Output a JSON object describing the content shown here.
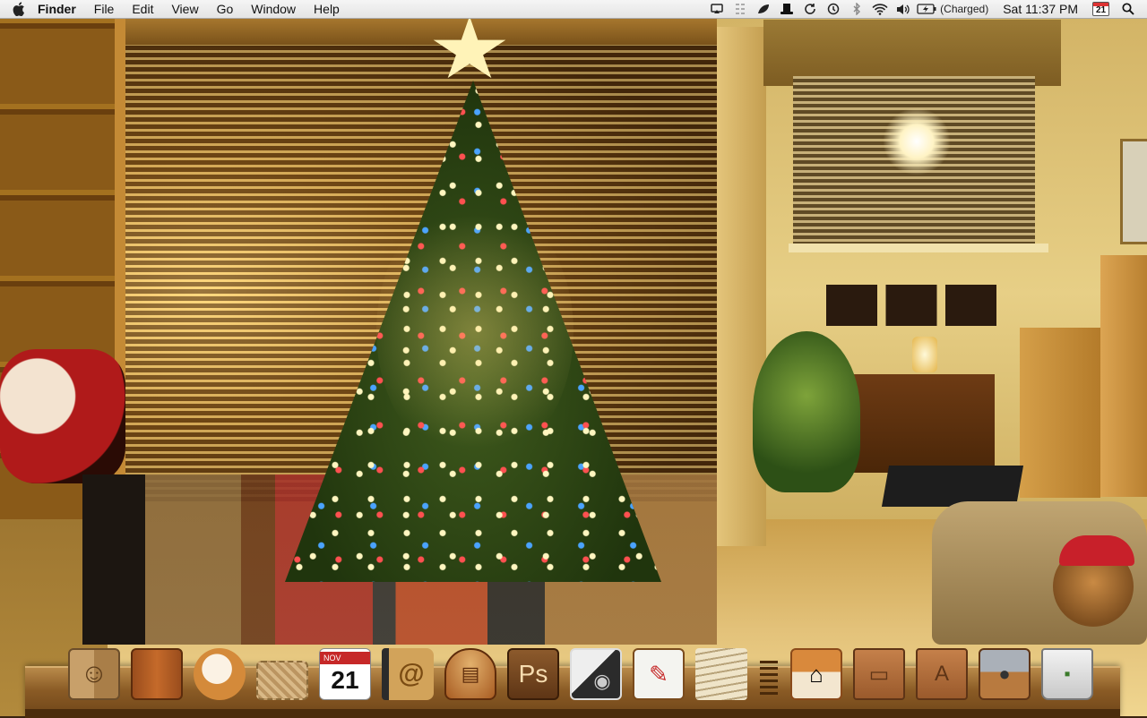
{
  "menubar": {
    "apple_icon": "apple-logo",
    "app_name": "Finder",
    "menus": [
      "File",
      "Edit",
      "View",
      "Go",
      "Window",
      "Help"
    ],
    "status_icons": [
      "airplay-icon",
      "grid-icon",
      "leaf-icon",
      "hat-icon",
      "sync-icon",
      "time-machine-icon",
      "bluetooth-icon",
      "wifi-icon",
      "volume-icon",
      "battery-icon"
    ],
    "battery_status": "(Charged)",
    "clock": "Sat 11:37 PM",
    "calendar_day": "21",
    "spotlight_icon": "search-icon"
  },
  "dock": {
    "ical_month": "NOV",
    "ical_day": "21",
    "photoshop_label": "Ps",
    "address_book_label": "@",
    "items": [
      "finder-icon",
      "apple-wood-icon",
      "squirrel-icon",
      "mail-stamp-icon",
      "ical-icon",
      "address-book-icon",
      "radio-icon",
      "photoshop-icon",
      "photo-camera-icon",
      "textedit-icon",
      "papers-icon",
      "home-folder-icon",
      "documents-folder-icon",
      "applications-folder-icon",
      "bear-box-icon",
      "trash-icon"
    ]
  },
  "colors": {
    "menubar_bg": "#ececec",
    "dock_wood": "#8a5b25"
  }
}
